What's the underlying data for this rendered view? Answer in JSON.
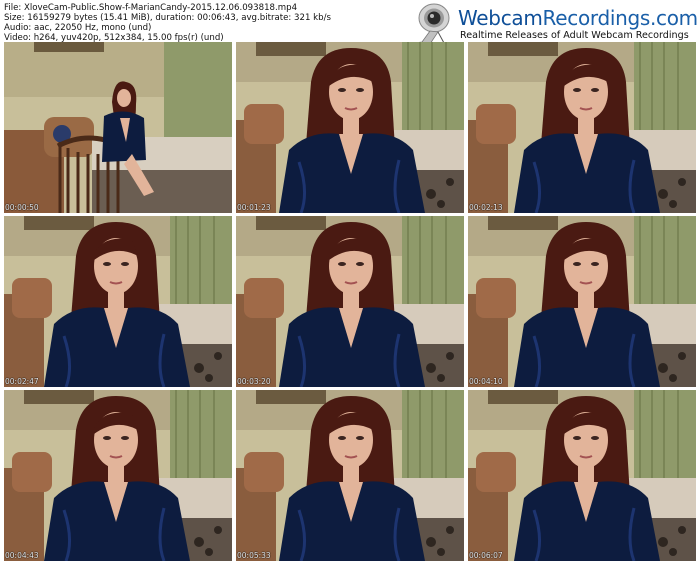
{
  "header": {
    "file_line": "File: XloveCam-Public.Show-f-MarianCandy-2015.12.06.093818.mp4",
    "size_line": "Size: 16159279 bytes (15.41 MiB), duration: 00:06:43, avg.bitrate: 321 kb/s",
    "audio_line": "Audio: aac, 22050 Hz, mono (und)",
    "video_line": "Video: h264, yuv420p, 512x384, 15.00 fps(r) (und)"
  },
  "brand": {
    "name_part1": "Webcam",
    "name_part2": "Recordings.com",
    "tagline": "Realtime Releases of Adult Webcam Recordings"
  },
  "frames": [
    {
      "time": "00:00:50",
      "scene": "wide"
    },
    {
      "time": "00:01:23",
      "scene": "close"
    },
    {
      "time": "00:02:13",
      "scene": "close"
    },
    {
      "time": "00:02:47",
      "scene": "close"
    },
    {
      "time": "00:03:20",
      "scene": "close"
    },
    {
      "time": "00:04:10",
      "scene": "close"
    },
    {
      "time": "00:04:43",
      "scene": "close"
    },
    {
      "time": "00:05:33",
      "scene": "close"
    },
    {
      "time": "00:06:07",
      "scene": "close"
    }
  ],
  "colors": {
    "brand_blue": "#1a5fa8",
    "wall": "#c8bf9a",
    "curtain": "#8f9a6a",
    "robe": "#0d1c3f",
    "hair": "#4a1a12",
    "skin": "#e2b49a"
  }
}
